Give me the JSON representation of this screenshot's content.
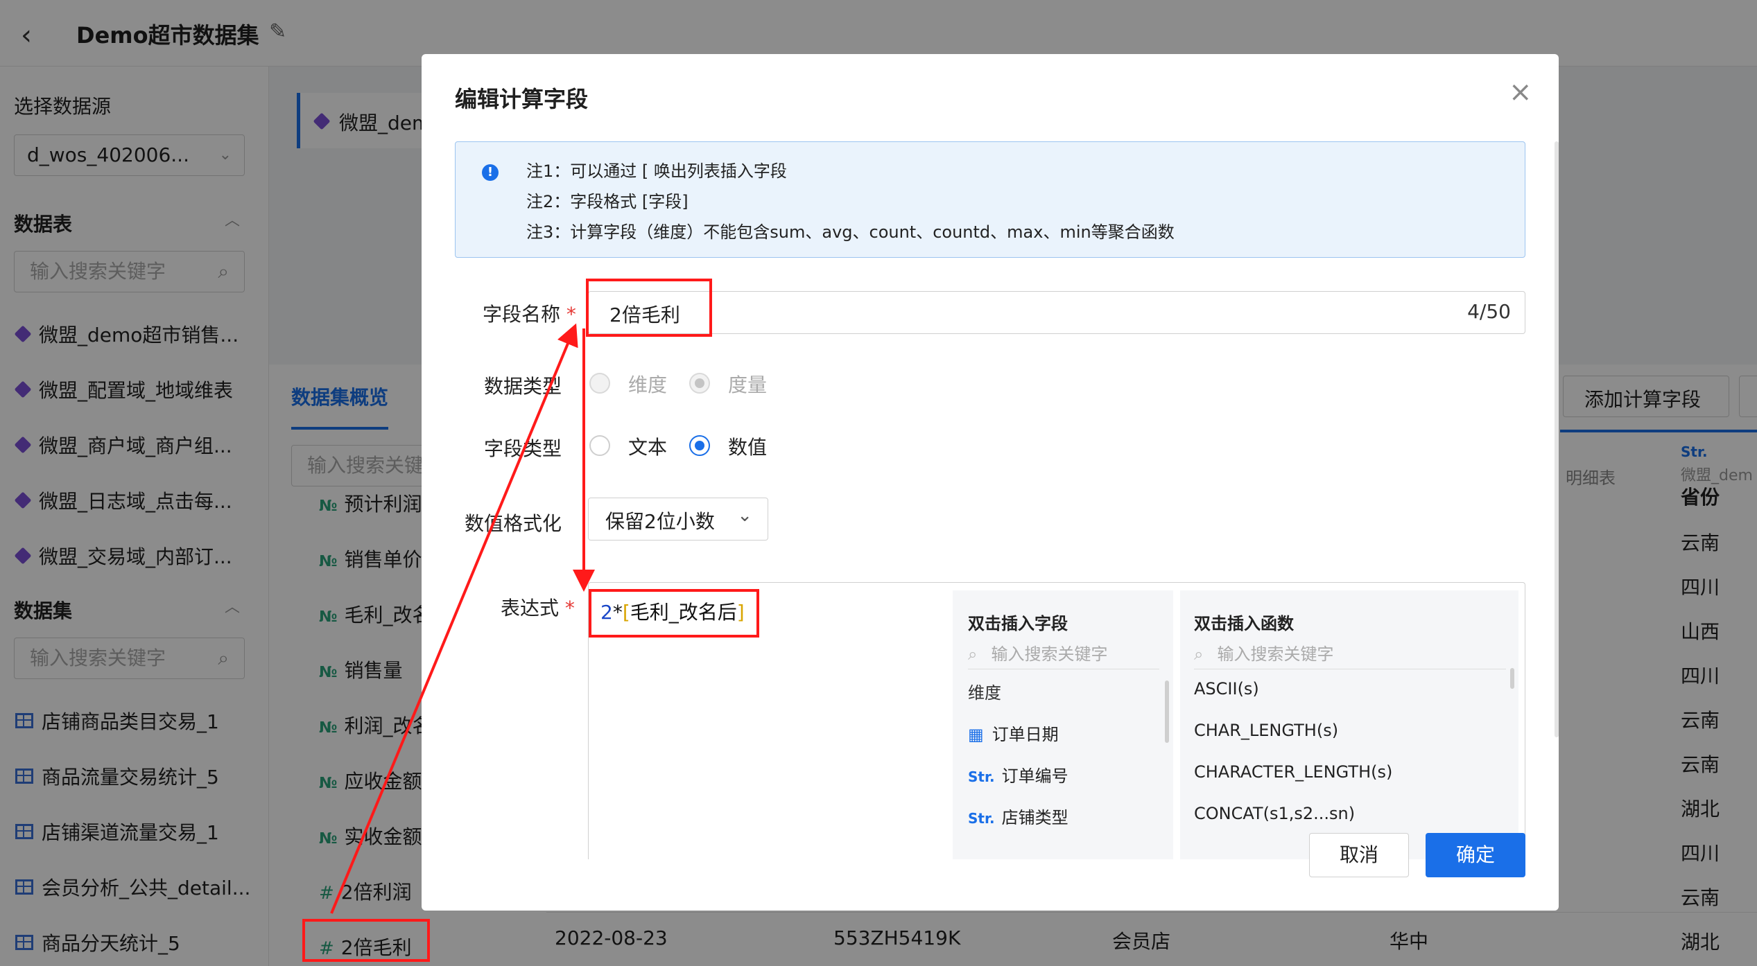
{
  "app": {
    "title": "Demo超市数据集"
  },
  "sidebar": {
    "source_label": "选择数据源",
    "source_value": "d_wos_402006...",
    "tables_title": "数据表",
    "tables_search_placeholder": "输入搜索关键字",
    "tables": [
      "微盟_demo超市销售...",
      "微盟_配置域_地域维表",
      "微盟_商户域_商户组...",
      "微盟_日志域_点击每...",
      "微盟_交易域_内部订..."
    ],
    "datasets_title": "数据集",
    "datasets_search_placeholder": "输入搜索关键字",
    "datasets": [
      "店铺商品类目交易_1",
      "商品流量交易统计_5",
      "店铺渠道流量交易_1",
      "会员分析_公共_detail...",
      "商品分天统计_5"
    ]
  },
  "main": {
    "source_tab": "微盟_dem",
    "overview_tab": "数据集概览",
    "field_search_placeholder": "输入搜索关键",
    "fields": [
      {
        "tag": "№",
        "name": "预计利润"
      },
      {
        "tag": "№",
        "name": "销售单价"
      },
      {
        "tag": "№",
        "name": "毛利_改名"
      },
      {
        "tag": "№",
        "name": "销售量"
      },
      {
        "tag": "№",
        "name": "利润_改名"
      },
      {
        "tag": "№",
        "name": "应收金额"
      },
      {
        "tag": "№",
        "name": "实收金额"
      },
      {
        "tag": "#",
        "name": "2倍利润"
      },
      {
        "tag": "#",
        "name": "2倍毛利"
      }
    ],
    "add_calc_button": "添加计算字段",
    "detail_header": "明细表",
    "col_header": {
      "tag": "Str.",
      "table": "微盟_dem",
      "name": "省份"
    },
    "province_values": [
      "云南",
      "四川",
      "山西",
      "四川",
      "云南",
      "云南",
      "湖北",
      "四川",
      "云南",
      "湖北"
    ],
    "bottom_row": {
      "date": "2022-08-23",
      "id": "553ZH5419K",
      "type": "会员店",
      "region": "华中"
    }
  },
  "modal": {
    "title": "编辑计算字段",
    "notes": [
      "注1：可以通过 [ 唤出列表插入字段",
      "注2：字段格式 [字段]",
      "注3：计算字段（维度）不能包含sum、avg、count、countd、max、min等聚合函数"
    ],
    "name_label": "字段名称",
    "name_value": "2倍毛利",
    "name_count": "4/50",
    "data_type_label": "数据类型",
    "data_type_options": [
      "维度",
      "度量"
    ],
    "field_type_label": "字段类型",
    "field_type_options": [
      "文本",
      "数值"
    ],
    "format_label": "数值格式化",
    "format_value": "保留2位小数",
    "expr_label": "表达式",
    "expr_number": "2",
    "expr_op": "*",
    "expr_open": "[",
    "expr_field": "毛利_改名后",
    "expr_close": "]",
    "fields_panel": {
      "title": "双击插入字段",
      "placeholder": "输入搜索关键字",
      "group": "维度",
      "items": [
        {
          "tag": "cal",
          "name": "订单日期"
        },
        {
          "tag": "Str.",
          "name": "订单编号"
        },
        {
          "tag": "Str.",
          "name": "店铺类型"
        }
      ]
    },
    "func_panel": {
      "title": "双击插入函数",
      "placeholder": "输入搜索关键字",
      "items": [
        "ASCII(s)",
        "CHAR_LENGTH(s)",
        "CHARACTER_LENGTH(s)",
        "CONCAT(s1,s2...sn)"
      ]
    },
    "cancel": "取消",
    "confirm": "确定"
  },
  "colors": {
    "accent": "#1a6fe8",
    "annotation": "#ff1a1a",
    "field_tag": "#2aa37a"
  }
}
